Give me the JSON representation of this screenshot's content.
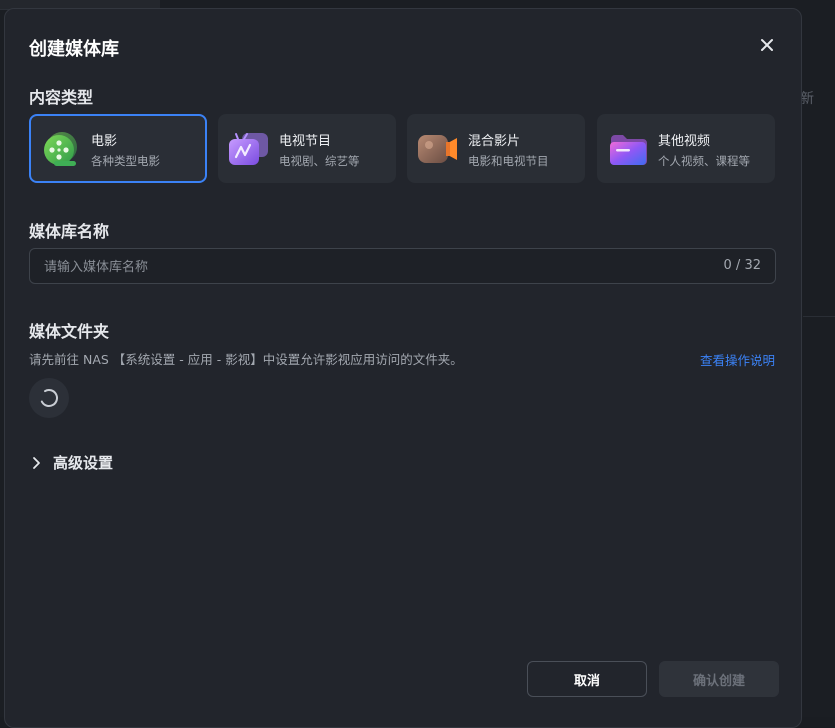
{
  "dialog": {
    "title": "创建媒体库"
  },
  "content_type": {
    "label": "内容类型",
    "cards": [
      {
        "name": "电影",
        "desc": "各种类型电影",
        "icon": "movie-reel-icon",
        "selected": true
      },
      {
        "name": "电视节目",
        "desc": "电视剧、综艺等",
        "icon": "tv-show-icon",
        "selected": false
      },
      {
        "name": "混合影片",
        "desc": "电影和电视节目",
        "icon": "video-camera-icon",
        "selected": false
      },
      {
        "name": "其他视频",
        "desc": "个人视频、课程等",
        "icon": "folder-icon",
        "selected": false
      }
    ]
  },
  "library_name": {
    "label": "媒体库名称",
    "placeholder": "请输入媒体库名称",
    "value": "",
    "counter": "0 / 32"
  },
  "media_folder": {
    "label": "媒体文件夹",
    "hint": "请先前往 NAS 【系统设置 - 应用 - 影视】中设置允许影视应用访问的文件夹。",
    "help_link": "查看操作说明"
  },
  "advanced": {
    "label": "高级设置"
  },
  "footer": {
    "cancel": "取消",
    "confirm": "确认创建"
  },
  "background": {
    "ghost_text": "新"
  },
  "colors": {
    "accent": "#3b82f6",
    "dialog_bg": "#22252c",
    "card_bg": "#2a2e35"
  }
}
